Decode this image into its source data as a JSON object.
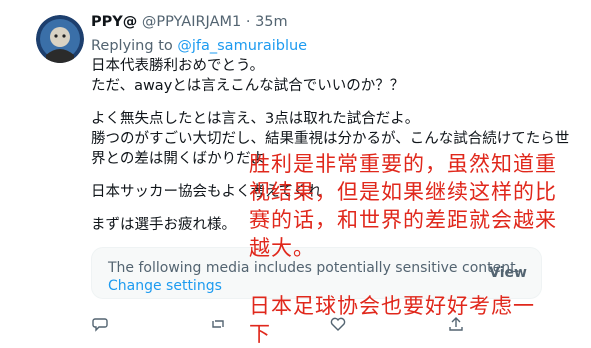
{
  "tweet": {
    "display_name": "PPY@",
    "handle": "@PPYAIRJAM1",
    "separator": "·",
    "time": "35m",
    "replying_prefix": "Replying to",
    "replying_to": "@jfa_samuraiblue",
    "lines": [
      "日本代表勝利おめでとう。",
      "ただ、awayとは言えこんな試合でいいのか？？",
      "",
      "よく無失点したとは言え、3点は取れた試合だよ。",
      "勝つのがすごい大切だし、結果重視は分かるが、こんな試合続けてたら世",
      "界との差は開くばかりだよ",
      "",
      "日本サッカー協会もよく考えてくれ",
      "",
      "まずは選手お疲れ様。"
    ],
    "sensitive_notice": "The following media includes potentially sensitive content.",
    "change_settings": "Change settings",
    "view_label": "View"
  },
  "translation_overlay": {
    "color": "#e0281c",
    "block1": [
      "胜利是非常重要的，虽然知道重",
      "视结果，但是如果继续这样的比",
      "赛的话，和世界的差距就会越来",
      "越大。"
    ],
    "block2": [
      "日本足球协会也要好好考虑一",
      "下"
    ]
  },
  "icons": [
    "avatar",
    "reply-icon",
    "retweet-icon",
    "like-icon",
    "share-icon"
  ]
}
